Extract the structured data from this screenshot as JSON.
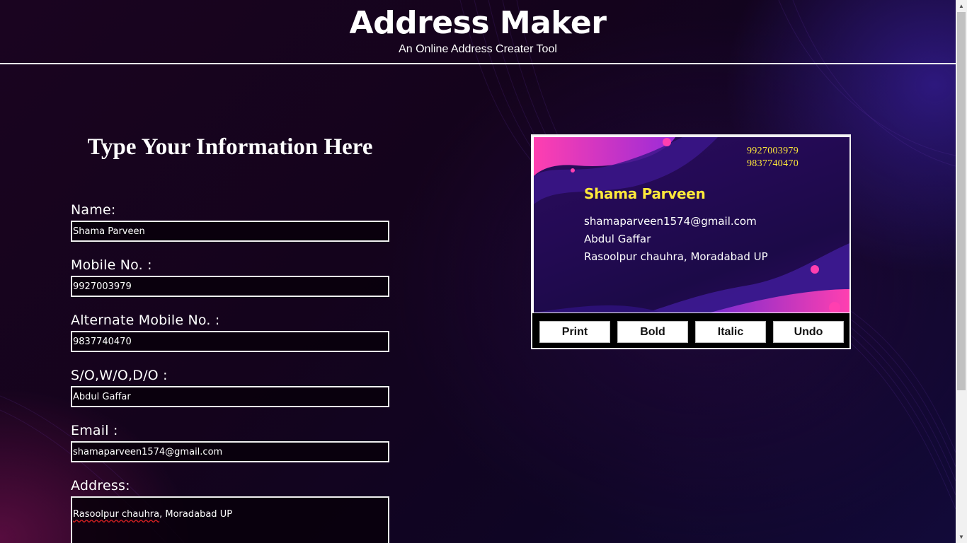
{
  "header": {
    "title": "Address Maker",
    "subtitle": "An Online Address Creater Tool"
  },
  "form": {
    "heading": "Type Your Information Here",
    "fields": [
      {
        "label": "Name:",
        "value": "Shama Parveen"
      },
      {
        "label": "Mobile No. :",
        "value": "9927003979"
      },
      {
        "label": "Alternate Mobile No. :",
        "value": "9837740470"
      },
      {
        "label": "S/O,W/O,D/O :",
        "value": "Abdul Gaffar"
      },
      {
        "label": "Email :",
        "value": "shamaparveen1574@gmail.com"
      }
    ],
    "address": {
      "label": "Address:",
      "value_first": "Rasoolpur chauhra",
      "value_rest": ", Moradabad UP"
    }
  },
  "card": {
    "mobile": "9927003979",
    "alt_mobile": "9837740470",
    "name": "Shama Parveen",
    "email": "shamaparveen1574@gmail.com",
    "relation": "Abdul Gaffar",
    "address": "Rasoolpur chauhra, Moradabad UP",
    "buttons": {
      "print": "Print",
      "bold": "Bold",
      "italic": "Italic",
      "undo": "Undo"
    }
  },
  "colors": {
    "accent_yellow": "#ffe93a",
    "card_bg": "#240a55",
    "page_bg": "#14031c"
  },
  "icons": [
    "scroll-up-arrow-icon",
    "scroll-down-arrow-icon"
  ]
}
